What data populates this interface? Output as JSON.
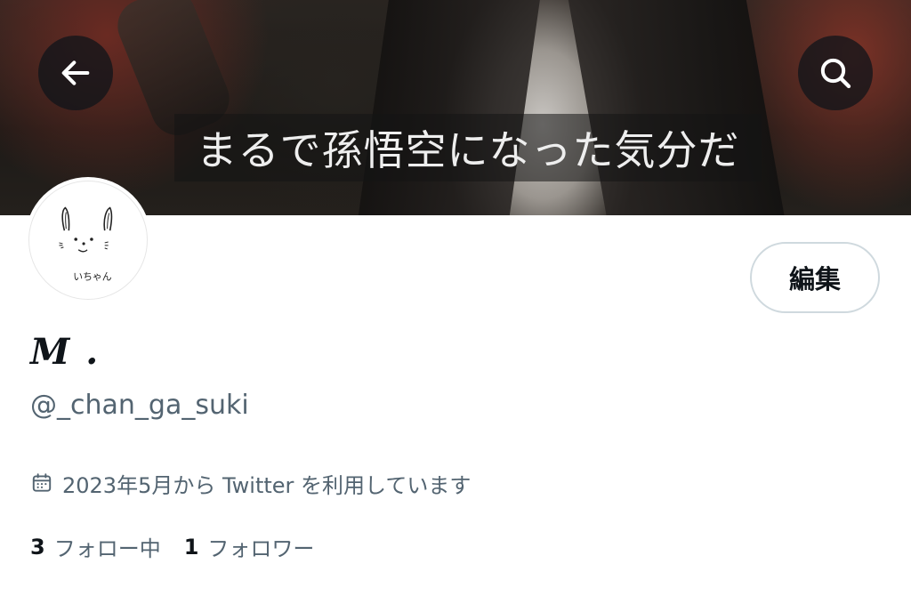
{
  "banner": {
    "subtitle": "まるで孫悟空になった気分だ"
  },
  "header": {
    "back_icon": "arrow-left-icon",
    "search_icon": "search-icon"
  },
  "profile": {
    "avatar_text": "いちゃん",
    "edit_label": "編集",
    "display_name": "M .",
    "handle": "@_chan_ga_suki",
    "joined_icon": "calendar-icon",
    "joined_text": "2023年5月から Twitter を利用しています",
    "following_count": "3",
    "following_label": "フォロー中",
    "followers_count": "1",
    "followers_label": "フォロワー"
  },
  "colors": {
    "text_primary": "#0f1419",
    "text_secondary": "#536471",
    "button_border": "#cfd9de"
  }
}
